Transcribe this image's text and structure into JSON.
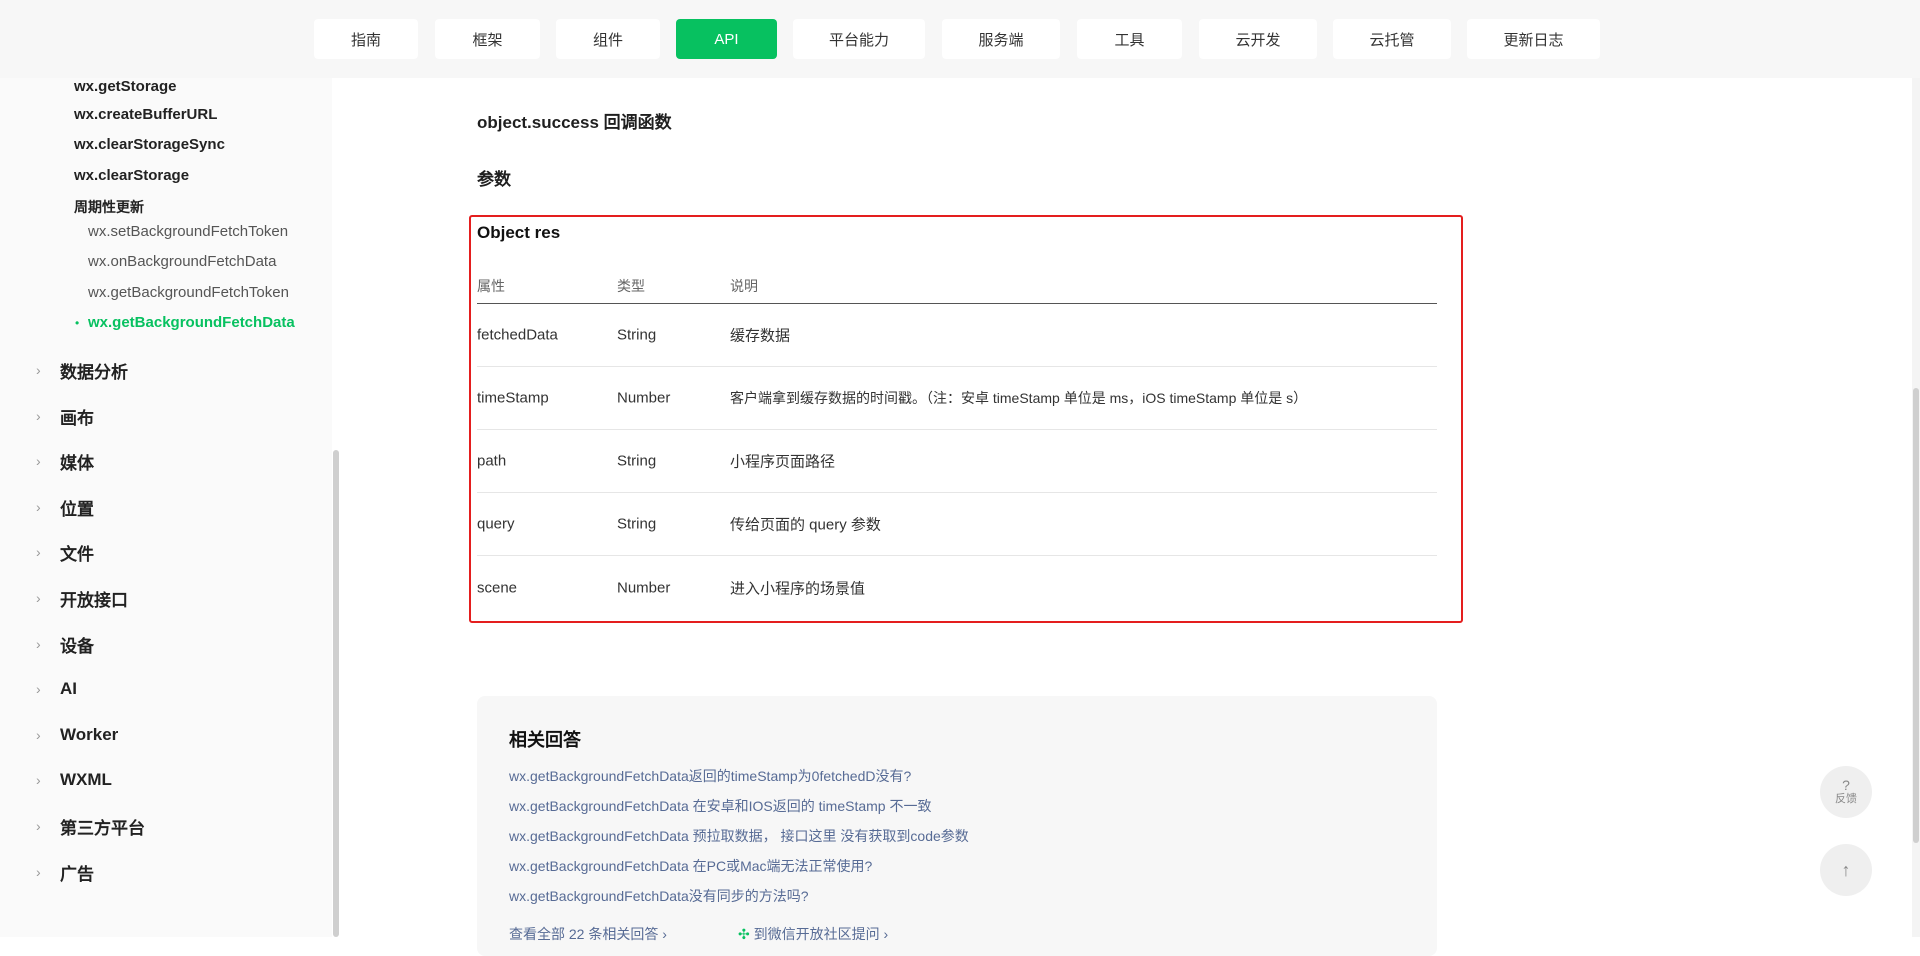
{
  "nav": {
    "tabs": [
      {
        "label": "指南",
        "active": false
      },
      {
        "label": "框架",
        "active": false
      },
      {
        "label": "组件",
        "active": false
      },
      {
        "label": "API",
        "active": true
      },
      {
        "label": "平台能力",
        "active": false
      },
      {
        "label": "服务端",
        "active": false
      },
      {
        "label": "工具",
        "active": false
      },
      {
        "label": "云开发",
        "active": false
      },
      {
        "label": "云托管",
        "active": false
      },
      {
        "label": "更新日志",
        "active": false
      }
    ],
    "accent_color": "#07c160"
  },
  "sidebar": {
    "sub_items": [
      "wx.getStorage",
      "wx.createBufferURL",
      "wx.clearStorageSync",
      "wx.clearStorage"
    ],
    "group_label": "周期性更新",
    "leaves": [
      "wx.setBackgroundFetchToken",
      "wx.onBackgroundFetchData",
      "wx.getBackgroundFetchToken",
      "wx.getBackgroundFetchData"
    ],
    "active_leaf": "wx.getBackgroundFetchData",
    "categories": [
      "数据分析",
      "画布",
      "媒体",
      "位置",
      "文件",
      "开放接口",
      "设备",
      "AI",
      "Worker",
      "WXML",
      "第三方平台",
      "广告"
    ]
  },
  "content": {
    "callback_heading": "object.success 回调函数",
    "params_heading": "参数",
    "object_title": "Object res",
    "table": {
      "headers": [
        "属性",
        "类型",
        "说明"
      ],
      "rows": [
        [
          "fetchedData",
          "String",
          "缓存数据"
        ],
        [
          "timeStamp",
          "Number",
          "客户端拿到缓存数据的时间戳。（注：安卓 timeStamp 单位是 ms，iOS timeStamp 单位是 s）"
        ],
        [
          "path",
          "String",
          "小程序页面路径"
        ],
        [
          "query",
          "String",
          "传给页面的 query 参数"
        ],
        [
          "scene",
          "Number",
          "进入小程序的场景值"
        ]
      ]
    },
    "related": {
      "title": "相关回答",
      "links": [
        "wx.getBackgroundFetchData返回的timeStamp为0fetchedD没有?",
        "wx.getBackgroundFetchData 在安卓和IOS返回的 timeStamp 不一致",
        "wx.getBackgroundFetchData 预拉取数据， 接口这里 没有获取到code参数",
        "wx.getBackgroundFetchData 在PC或Mac端无法正常使用?",
        "wx.getBackgroundFetchData没有同步的方法吗?"
      ],
      "more_label": "查看全部 22 条相关回答 ›",
      "community_label": "到微信开放社区提问 ›"
    }
  },
  "floating": {
    "feedback_icon": "?",
    "feedback_label": "反馈",
    "top_icon": "↑"
  }
}
